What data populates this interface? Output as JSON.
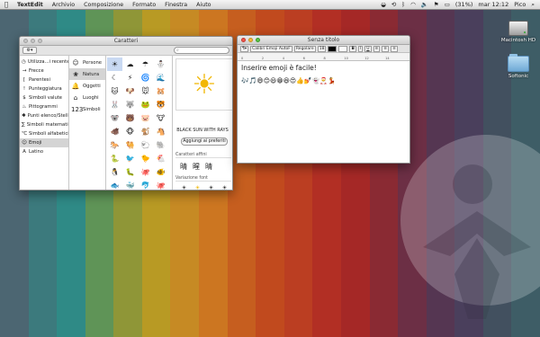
{
  "wallpaper": {
    "colors": [
      "#4c6672",
      "#3c7a7d",
      "#2f8a86",
      "#5f9457",
      "#8f9637",
      "#b89a24",
      "#c68a24",
      "#cc7621",
      "#c65e1f",
      "#c14a1e",
      "#bb3e22",
      "#b22f24",
      "#a52826",
      "#8a2a33",
      "#6c2f45",
      "#553652",
      "#4a3f5c",
      "#42505f",
      "#3e5d66"
    ]
  },
  "menubar": {
    "apple_icon": "apple-logo-icon",
    "app_name": "TextEdit",
    "menus": [
      "Archivio",
      "Composizione",
      "Formato",
      "Finestra",
      "Aiuto"
    ],
    "battery": "(31%)",
    "clock": "mar 12:12",
    "user": "Pico"
  },
  "characters_window": {
    "title": "Caratteri",
    "search_placeholder": "",
    "categories": [
      {
        "icon": "clock-icon",
        "label": "Utilizza...i recente"
      },
      {
        "icon": "arrow-icon",
        "label": "Frecce"
      },
      {
        "icon": "parenthesis-icon",
        "label": "Parentesi"
      },
      {
        "icon": "punctuation-icon",
        "label": "Punteggiatura"
      },
      {
        "icon": "currency-icon",
        "label": "Simboli valute"
      },
      {
        "icon": "pictogram-icon",
        "label": "Pittogrammi"
      },
      {
        "icon": "bullet-icon",
        "label": "Punti elenco/Stelle"
      },
      {
        "icon": "math-icon",
        "label": "Simboli matematici"
      },
      {
        "icon": "letterlike-icon",
        "label": "Simboli alfabetici"
      },
      {
        "icon": "emoji-icon",
        "label": "Emoji"
      },
      {
        "icon": "latin-icon",
        "label": "Latino"
      }
    ],
    "selected_category": "Emoji",
    "subcategories": [
      {
        "icon": "☺",
        "label": "Persone"
      },
      {
        "icon": "❀",
        "label": "Natura"
      },
      {
        "icon": "🔔",
        "label": "Oggetti"
      },
      {
        "icon": "⌂",
        "label": "Luoghi"
      },
      {
        "icon": "123",
        "label": "Simboli"
      }
    ],
    "selected_subcategory": "Natura",
    "grid": [
      "☀",
      "☁",
      "☂",
      "⛄",
      "☾",
      "⚡",
      "🌀",
      "🌊",
      "🐱",
      "🐶",
      "🐭",
      "🐹",
      "🐰",
      "🐺",
      "🐸",
      "🐯",
      "🐨",
      "🐻",
      "🐷",
      "🐮",
      "🐗",
      "🐵",
      "🐒",
      "🐴",
      "🐎",
      "🐫",
      "🐑",
      "🐘",
      "🐍",
      "🐦",
      "🐤",
      "🐔",
      "🐧",
      "🐛",
      "🐙",
      "🐠",
      "🐟",
      "🐳",
      "🐬",
      "🐙",
      "🌸",
      "🌹",
      "🌺",
      "🌻",
      "🌷",
      "🍀",
      "🌿",
      "🍁"
    ],
    "selected_char": "☀",
    "preview_char": "☀",
    "char_name": "BLACK SUN WITH RAYS",
    "add_favorite": "Aggiungi ai preferiti",
    "related_title": "Caratteri affini",
    "related_chars": [
      "晴",
      "暒",
      "晴"
    ],
    "font_variation_title": "Variazione font",
    "font_variations": [
      "☀",
      "☀",
      "☀",
      "☀",
      "☀",
      "☀",
      "☀",
      "☀"
    ]
  },
  "document_window": {
    "title": "Senza titolo",
    "format_bar": {
      "font": "Calibri Emoji AutoF",
      "style": "Regolare",
      "size": "18"
    },
    "ruler_ticks": [
      "0",
      "2",
      "4",
      "6",
      "8",
      "10",
      "12",
      "14"
    ],
    "text_line1": "Inserire emoji è facile!",
    "text_line2": "🎶🎵😄😊😃😁😆😍👍💅👻🎅💃"
  },
  "desktop": {
    "icons": [
      {
        "type": "hdd",
        "label": "Macintosh HD"
      },
      {
        "type": "folder",
        "label": "Softonic"
      }
    ]
  }
}
